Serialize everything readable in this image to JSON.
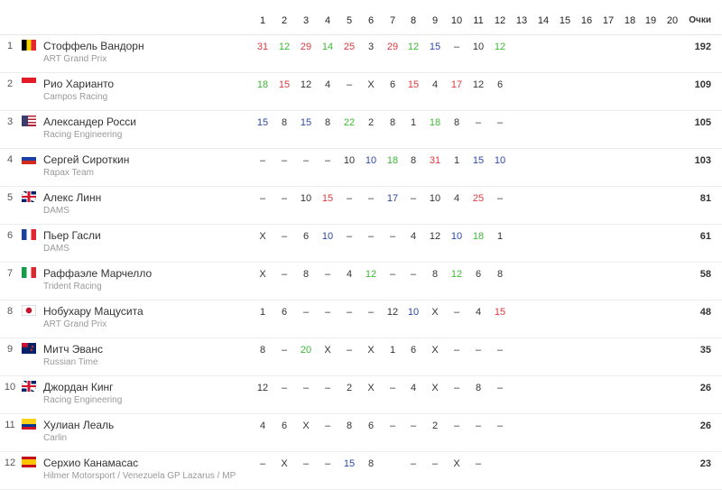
{
  "header": {
    "rounds": [
      "1",
      "2",
      "3",
      "4",
      "5",
      "6",
      "7",
      "8",
      "9",
      "10",
      "11",
      "12",
      "13",
      "14",
      "15",
      "16",
      "17",
      "18",
      "19",
      "20"
    ],
    "points_label": "Очки"
  },
  "colors": {
    "red": "#e0393e",
    "green": "#3cb834",
    "blue": "#2b47a8"
  },
  "rows": [
    {
      "pos": "1",
      "name": "Стоффель Вандорн",
      "team": "ART Grand Prix",
      "flag": "belgium-flag",
      "points": "192",
      "results": [
        [
          "31",
          "red"
        ],
        [
          "12",
          "green"
        ],
        [
          "29",
          "red"
        ],
        [
          "14",
          "green"
        ],
        [
          "25",
          "red"
        ],
        [
          "3",
          ""
        ],
        [
          "29",
          "red"
        ],
        [
          "12",
          "green"
        ],
        [
          "15",
          "blue"
        ],
        [
          "–",
          ""
        ],
        [
          "10",
          ""
        ],
        [
          "12",
          "green"
        ]
      ]
    },
    {
      "pos": "2",
      "name": "Рио Харианто",
      "team": "Campos Racing",
      "flag": "indonesia-flag",
      "points": "109",
      "results": [
        [
          "18",
          "green"
        ],
        [
          "15",
          "red"
        ],
        [
          "12",
          ""
        ],
        [
          "4",
          ""
        ],
        [
          "–",
          ""
        ],
        [
          "X",
          ""
        ],
        [
          "6",
          ""
        ],
        [
          "15",
          "red"
        ],
        [
          "4",
          ""
        ],
        [
          "17",
          "red"
        ],
        [
          "12",
          ""
        ],
        [
          "6",
          ""
        ]
      ]
    },
    {
      "pos": "3",
      "name": "Александер Росси",
      "team": "Racing Engineering",
      "flag": "usa-flag",
      "points": "105",
      "results": [
        [
          "15",
          "blue"
        ],
        [
          "8",
          ""
        ],
        [
          "15",
          "blue"
        ],
        [
          "8",
          ""
        ],
        [
          "22",
          "green"
        ],
        [
          "2",
          ""
        ],
        [
          "8",
          ""
        ],
        [
          "1",
          ""
        ],
        [
          "18",
          "green"
        ],
        [
          "8",
          ""
        ],
        [
          "–",
          ""
        ],
        [
          "–",
          ""
        ]
      ]
    },
    {
      "pos": "4",
      "name": "Сергей Сироткин",
      "team": "Rapax Team",
      "flag": "russia-flag",
      "points": "103",
      "results": [
        [
          "–",
          ""
        ],
        [
          "–",
          ""
        ],
        [
          "–",
          ""
        ],
        [
          "–",
          ""
        ],
        [
          "10",
          ""
        ],
        [
          "10",
          "blue"
        ],
        [
          "18",
          "green"
        ],
        [
          "8",
          ""
        ],
        [
          "31",
          "red"
        ],
        [
          "1",
          ""
        ],
        [
          "15",
          "blue"
        ],
        [
          "10",
          "blue"
        ]
      ]
    },
    {
      "pos": "5",
      "name": "Алекс Линн",
      "team": "DAMS",
      "flag": "uk-flag",
      "points": "81",
      "results": [
        [
          "–",
          ""
        ],
        [
          "–",
          ""
        ],
        [
          "10",
          ""
        ],
        [
          "15",
          "red"
        ],
        [
          "–",
          ""
        ],
        [
          "–",
          ""
        ],
        [
          "17",
          "blue"
        ],
        [
          "–",
          ""
        ],
        [
          "10",
          ""
        ],
        [
          "4",
          ""
        ],
        [
          "25",
          "red"
        ],
        [
          "–",
          ""
        ]
      ]
    },
    {
      "pos": "6",
      "name": "Пьер Гасли",
      "team": "DAMS",
      "flag": "france-flag",
      "points": "61",
      "results": [
        [
          "X",
          ""
        ],
        [
          "–",
          ""
        ],
        [
          "6",
          ""
        ],
        [
          "10",
          "blue"
        ],
        [
          "–",
          ""
        ],
        [
          "–",
          ""
        ],
        [
          "–",
          ""
        ],
        [
          "4",
          ""
        ],
        [
          "12",
          ""
        ],
        [
          "10",
          "blue"
        ],
        [
          "18",
          "green"
        ],
        [
          "1",
          ""
        ]
      ]
    },
    {
      "pos": "7",
      "name": "Раффаэле Марчелло",
      "team": "Trident Racing",
      "flag": "italy-flag",
      "points": "58",
      "results": [
        [
          "X",
          ""
        ],
        [
          "–",
          ""
        ],
        [
          "8",
          ""
        ],
        [
          "–",
          ""
        ],
        [
          "4",
          ""
        ],
        [
          "12",
          "green"
        ],
        [
          "–",
          ""
        ],
        [
          "–",
          ""
        ],
        [
          "8",
          ""
        ],
        [
          "12",
          "green"
        ],
        [
          "6",
          ""
        ],
        [
          "8",
          ""
        ]
      ]
    },
    {
      "pos": "8",
      "name": "Нобухару Мацусита",
      "team": "ART Grand Prix",
      "flag": "japan-flag",
      "points": "48",
      "results": [
        [
          "1",
          ""
        ],
        [
          "6",
          ""
        ],
        [
          "–",
          ""
        ],
        [
          "–",
          ""
        ],
        [
          "–",
          ""
        ],
        [
          "–",
          ""
        ],
        [
          "12",
          ""
        ],
        [
          "10",
          "blue"
        ],
        [
          "X",
          ""
        ],
        [
          "–",
          ""
        ],
        [
          "4",
          ""
        ],
        [
          "15",
          "red"
        ]
      ]
    },
    {
      "pos": "9",
      "name": "Митч Эванс",
      "team": "Russian Time",
      "flag": "new-zealand-flag",
      "points": "35",
      "results": [
        [
          "8",
          ""
        ],
        [
          "–",
          ""
        ],
        [
          "20",
          "green"
        ],
        [
          "X",
          ""
        ],
        [
          "–",
          ""
        ],
        [
          "X",
          ""
        ],
        [
          "1",
          ""
        ],
        [
          "6",
          ""
        ],
        [
          "X",
          ""
        ],
        [
          "–",
          ""
        ],
        [
          "–",
          ""
        ],
        [
          "–",
          ""
        ]
      ]
    },
    {
      "pos": "10",
      "name": "Джордан Кинг",
      "team": "Racing Engineering",
      "flag": "uk-flag",
      "points": "26",
      "results": [
        [
          "12",
          ""
        ],
        [
          "–",
          ""
        ],
        [
          "–",
          ""
        ],
        [
          "–",
          ""
        ],
        [
          "2",
          ""
        ],
        [
          "X",
          ""
        ],
        [
          "–",
          ""
        ],
        [
          "4",
          ""
        ],
        [
          "X",
          ""
        ],
        [
          "–",
          ""
        ],
        [
          "8",
          ""
        ],
        [
          "–",
          ""
        ]
      ]
    },
    {
      "pos": "11",
      "name": "Хулиан Леаль",
      "team": "Carlin",
      "flag": "colombia-flag",
      "points": "26",
      "results": [
        [
          "4",
          ""
        ],
        [
          "6",
          ""
        ],
        [
          "X",
          ""
        ],
        [
          "–",
          ""
        ],
        [
          "8",
          ""
        ],
        [
          "6",
          ""
        ],
        [
          "–",
          ""
        ],
        [
          "–",
          ""
        ],
        [
          "2",
          ""
        ],
        [
          "–",
          ""
        ],
        [
          "–",
          ""
        ],
        [
          "–",
          ""
        ]
      ]
    },
    {
      "pos": "12",
      "name": "Серхио Канамасас",
      "team": "Hilmer Motorsport / Venezuela GP Lazarus / MP",
      "flag": "spain-flag",
      "points": "23",
      "results": [
        [
          "–",
          ""
        ],
        [
          "X",
          ""
        ],
        [
          "–",
          ""
        ],
        [
          "–",
          ""
        ],
        [
          "15",
          "blue"
        ],
        [
          "8",
          ""
        ],
        [
          "",
          ""
        ],
        [
          "–",
          ""
        ],
        [
          "–",
          ""
        ],
        [
          "X",
          ""
        ],
        [
          "–",
          ""
        ],
        [
          "",
          ""
        ]
      ]
    }
  ]
}
